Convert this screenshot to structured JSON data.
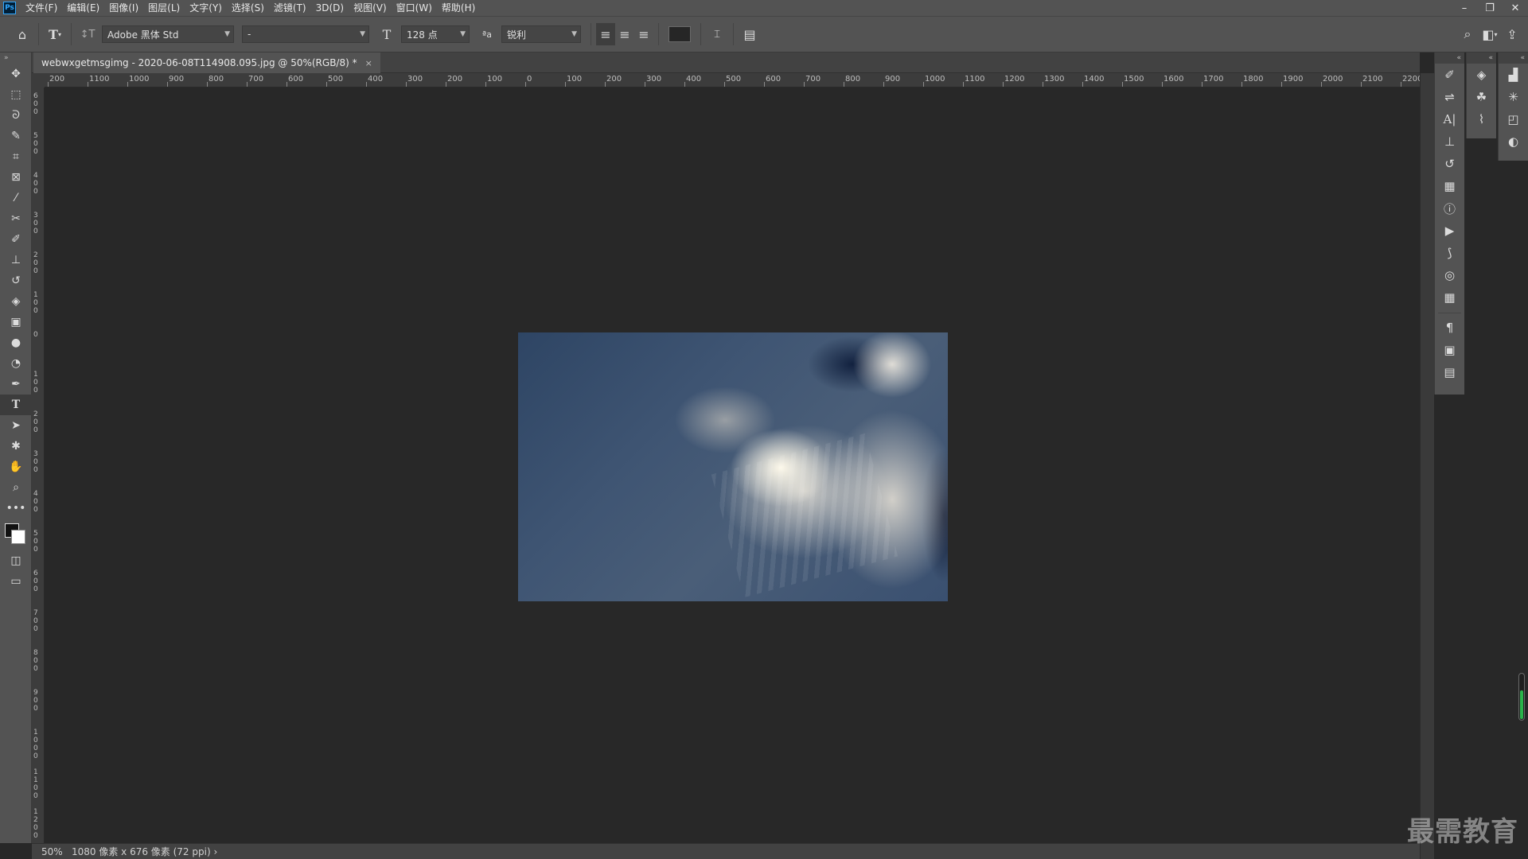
{
  "menu": {
    "logo": "Ps",
    "items": [
      "文件(F)",
      "编辑(E)",
      "图像(I)",
      "图层(L)",
      "文字(Y)",
      "选择(S)",
      "滤镜(T)",
      "3D(D)",
      "视图(V)",
      "窗口(W)",
      "帮助(H)"
    ],
    "window_controls": [
      "–",
      "❐",
      "✕"
    ]
  },
  "options": {
    "font_family": "Adobe 黑体 Std",
    "font_style": "-",
    "font_size": "128 点",
    "aa_label": "ªa",
    "antialias": "锐利",
    "text_color": "#262626"
  },
  "document": {
    "tab_title": "webwxgetmsgimg - 2020-06-08T114908.095.jpg @ 50%(RGB/8) *",
    "close": "×"
  },
  "rulers": {
    "h_labels": [
      "200",
      "1100",
      "1000",
      "900",
      "800",
      "700",
      "600",
      "500",
      "400",
      "300",
      "200",
      "100",
      "0",
      "100",
      "200",
      "300",
      "400",
      "500",
      "600",
      "700",
      "800",
      "900",
      "1000",
      "1100",
      "1200",
      "1300",
      "1400",
      "1500",
      "1600",
      "1700",
      "1800",
      "1900",
      "2000",
      "2100",
      "2200"
    ],
    "v_labels": [
      "600",
      "500",
      "400",
      "300",
      "200",
      "100",
      "0",
      "100",
      "200",
      "300",
      "400",
      "500",
      "600",
      "700",
      "800",
      "900",
      "1000",
      "1100",
      "1200"
    ]
  },
  "status": {
    "zoom": "50%",
    "doc_info": "1080 像素 x 676 像素 (72 ppi) ›"
  },
  "watermark": "最需教育"
}
